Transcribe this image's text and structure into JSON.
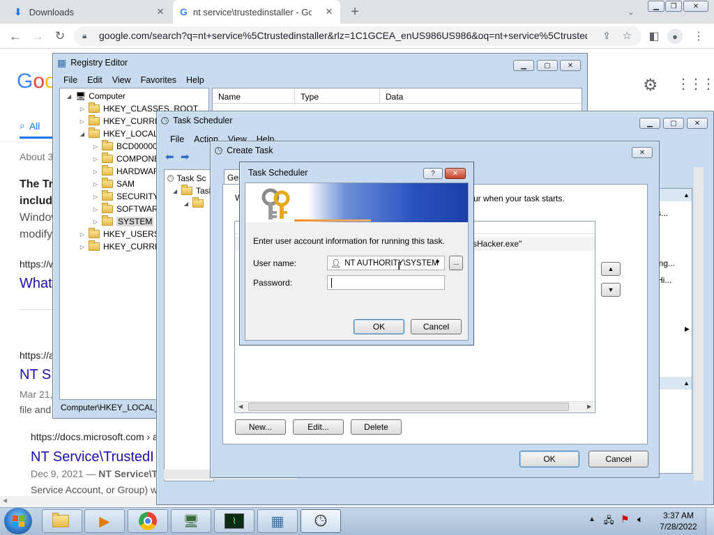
{
  "browser": {
    "tabs": [
      {
        "label": "Downloads",
        "active": false
      },
      {
        "label": "nt service\\trustedinstaller - Goog",
        "active": true
      }
    ],
    "url": "google.com/search?q=nt+service%5Ctrustedinstaller&rlz=1C1GCEA_enUS986US986&oq=nt+service%5Ctrusted..."
  },
  "google": {
    "logo": "Goo",
    "tab_all": "All",
    "about": "About 3",
    "result1": {
      "heading_line1": "The Tr",
      "heading_line2": "include",
      "snippet_line1": "Window",
      "snippet_line2": "modify",
      "cite": "https://w",
      "title": "What"
    },
    "result2": {
      "cite": "https://a",
      "title": "NT S",
      "date": "Mar 21,",
      "snippet": "file and"
    },
    "result3": {
      "cite": "https://docs.microsoft.com › a",
      "title": "NT Service\\TrustedI",
      "date": "Dec 9, 2021 — ",
      "date_bold": "NT Service\\Tr",
      "snippet": "Service Account, or Group) w"
    }
  },
  "registry_editor": {
    "title": "Registry Editor",
    "menu": [
      "File",
      "Edit",
      "View",
      "Favorites",
      "Help"
    ],
    "tree": [
      {
        "label": "Computer",
        "level": 0,
        "expander": "◢"
      },
      {
        "label": "HKEY_CLASSES_ROOT",
        "level": 1,
        "expander": "▷"
      },
      {
        "label": "HKEY_CURREN",
        "level": 1,
        "expander": "▷"
      },
      {
        "label": "HKEY_LOCAL_",
        "level": 1,
        "expander": "◢"
      },
      {
        "label": "BCD000000",
        "level": 2,
        "expander": "▷"
      },
      {
        "label": "COMPONE",
        "level": 2,
        "expander": "▷"
      },
      {
        "label": "HARDWAR",
        "level": 2,
        "expander": "▷"
      },
      {
        "label": "SAM",
        "level": 2,
        "expander": "▷"
      },
      {
        "label": "SECURITY",
        "level": 2,
        "expander": "▷"
      },
      {
        "label": "SOFTWARE",
        "level": 2,
        "expander": "▷"
      },
      {
        "label": "SYSTEM",
        "level": 2,
        "expander": "▷"
      },
      {
        "label": "HKEY_USERS",
        "level": 1,
        "expander": "▷"
      },
      {
        "label": "HKEY_CURREN",
        "level": 1,
        "expander": "▷"
      }
    ],
    "columns": [
      "Name",
      "Type",
      "Data"
    ],
    "statusbar": "Computer\\HKEY_LOCAL_M"
  },
  "task_scheduler": {
    "title": "Task Scheduler",
    "menu": [
      "File",
      "Action",
      "View",
      "Help"
    ],
    "tree_root": "Task Sc",
    "tree_child": "Task"
  },
  "create_task": {
    "title": "Create Task",
    "tab_label": "Ger",
    "description_tail": "ur when your task starts.",
    "action_tail": "sHacker.exe\"",
    "right_items": [
      "s...",
      "ing...",
      "Hi..."
    ],
    "buttons": {
      "new": "New...",
      "edit": "Edit...",
      "delete": "Delete",
      "ok": "OK",
      "cancel": "Cancel"
    }
  },
  "credentials_dialog": {
    "title": "Task Scheduler",
    "help": "?",
    "close": "✕",
    "prompt": "Enter user account information for running this task.",
    "username_label": "User name:",
    "username_value": "NT AUTHORITY\\SYSTEM",
    "password_label": "Password:",
    "password_value": "",
    "browse": "...",
    "ok": "OK",
    "cancel": "Cancel"
  },
  "taskbar": {
    "time": "3:37 AM",
    "date": "7/28/2022"
  }
}
